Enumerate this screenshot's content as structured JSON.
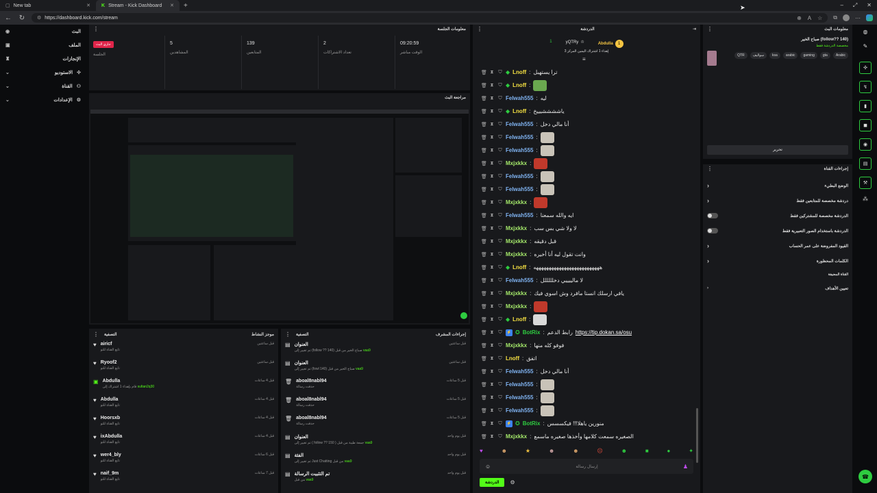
{
  "browser": {
    "tabs": [
      {
        "title": "New tab"
      },
      {
        "title": "Stream - Kick Dashboard"
      }
    ],
    "url": "https://dashboard.kick.com/stream"
  },
  "sidebar": {
    "items": [
      {
        "label": "البث",
        "icon": "broadcast-icon"
      },
      {
        "label": "الملف",
        "icon": "profile-icon"
      },
      {
        "label": "الإنجازات",
        "icon": "trophy-icon"
      },
      {
        "label": "الاستوديو",
        "icon": "studio-icon"
      },
      {
        "label": "القناة",
        "icon": "channel-icon"
      },
      {
        "label": "الإعدادات",
        "icon": "gear-icon"
      }
    ]
  },
  "session": {
    "header": "معلومات الجلسة",
    "stats": [
      {
        "value": "جاري البث",
        "label": "الجلسة"
      },
      {
        "value": "5",
        "label": "المشاهدين"
      },
      {
        "value": "139",
        "label": "المتابعين"
      },
      {
        "value": "2",
        "label": "تعداد الاشتراكات"
      },
      {
        "value": "09:20:59",
        "label": "الوقت مباشر"
      }
    ]
  },
  "preview": {
    "header": "مراجعة البث"
  },
  "activity": {
    "header": "موجز النشاط",
    "filter": "التصفية",
    "items": [
      {
        "name": "airicf",
        "sub": "تابع القناة للتو",
        "time": "قبل ساعتين"
      },
      {
        "name": "Ryoof2",
        "sub": "تابع القناة للتو",
        "time": "قبل ساعتين"
      },
      {
        "name": "Abdulla",
        "sub": "قام بإهداء 1 اشتراك إلى",
        "extra": "sultan2q30",
        "time": "قبل 4 ساعات"
      },
      {
        "name": "Abdulla",
        "sub": "تابع القناة للتو",
        "time": "قبل 4 ساعات"
      },
      {
        "name": "Hoorsxb",
        "sub": "تابع القناة للتو",
        "time": "قبل 4 ساعات"
      },
      {
        "name": "ixAbdulla",
        "sub": "تابع القناة للتو",
        "time": "قبل 4 ساعات"
      },
      {
        "name": "wer4_bly",
        "sub": "تابع القناة للتو",
        "time": "قبل 6 ساعات"
      },
      {
        "name": "naif_9m",
        "sub": "تابع القناة للتو",
        "time": "قبل 7 ساعات"
      }
    ]
  },
  "modactions": {
    "header": "إجراءات المشرف",
    "filter": "التصفية",
    "items": [
      {
        "name": "العنوان",
        "sub": "تم تغيير إلى (follow ?? 140) صباح الخير من قبل",
        "by": "vaa9",
        "time": "قبل ساعتين"
      },
      {
        "name": "العنوان",
        "sub": "تم تغيير إلى (fowl 140) صباح الخير من قبل",
        "by": "vaa9",
        "time": "قبل ساعتين"
      },
      {
        "name": "aboal8nabl94",
        "sub": "حذفت رسالة",
        "time": "قبل 5 ساعات"
      },
      {
        "name": "aboal8nabl94",
        "sub": "حذفت رسالة",
        "time": "قبل 5 ساعات"
      },
      {
        "name": "aboal8nabl94",
        "sub": "حذفت رسالة",
        "time": "قبل 5 ساعات"
      },
      {
        "name": "العنوان",
        "sub": "تم تغيير إلى ( follow ?? 150 ) جمعة طيبة من قبل",
        "by": "vaa9",
        "time": "قبل يوم واحد"
      },
      {
        "name": "الفئة",
        "sub": "تم تغيير إلى Just Chatting من قبل",
        "by": "vaa9",
        "time": "قبل يوم واحد"
      },
      {
        "name": "تم التثبيت الرسالة",
        "sub": "من قبل",
        "by": "vaa9",
        "time": "قبل يوم واحد"
      }
    ]
  },
  "chat": {
    "header": "الدردشة",
    "top_users": [
      {
        "name": "Abdulla",
        "count": "1"
      },
      {
        "name": "yQTRy",
        "count": "1"
      },
      {
        "name": "",
        "count": "1"
      }
    ],
    "gift_text": "إهداء 1 اشتراك اليمين المركز 3",
    "messages": [
      {
        "user": "Lnoff",
        "color": "#f5e042",
        "badge": true,
        "text": "ترا يستهبل"
      },
      {
        "user": "Lnoff",
        "color": "#f5e042",
        "badge": true,
        "text": "",
        "emote": "#6aa84f"
      },
      {
        "user": "Felwah555",
        "color": "#7fb2f0",
        "text": "ليه"
      },
      {
        "user": "Lnoff",
        "color": "#f5e042",
        "badge": true,
        "text": "ياششششيييخ"
      },
      {
        "user": "Felwah555",
        "color": "#7fb2f0",
        "text": "أنا مالي دخل"
      },
      {
        "user": "Felwah555",
        "color": "#7fb2f0",
        "text": "",
        "emote": "#c9c3b8"
      },
      {
        "user": "Felwah555",
        "color": "#7fb2f0",
        "text": "",
        "emote": "#c9c3b8"
      },
      {
        "user": "Mxjxkkx",
        "color": "#a4e86a",
        "text": "",
        "emote": "#c0392b"
      },
      {
        "user": "Felwah555",
        "color": "#7fb2f0",
        "text": "",
        "emote": "#c9c3b8"
      },
      {
        "user": "Felwah555",
        "color": "#7fb2f0",
        "text": "",
        "emote": "#c9c3b8"
      },
      {
        "user": "Mxjxkkx",
        "color": "#a4e86a",
        "text": "",
        "emote": "#c0392b"
      },
      {
        "user": "Felwah555",
        "color": "#7fb2f0",
        "text": "ايه والله سمعنا"
      },
      {
        "user": "Mxjxkkx",
        "color": "#a4e86a",
        "text": "لا ولا شي بس سب"
      },
      {
        "user": "Mxjxkkx",
        "color": "#a4e86a",
        "text": "قبل دقيقه"
      },
      {
        "user": "Mxjxkkx",
        "color": "#a4e86a",
        "text": "وانت تقول ليه أنا أخيره"
      },
      {
        "user": "Lnoff",
        "color": "#f5e042",
        "badge": true,
        "text": "ههههههههههههههههههههههههههه"
      },
      {
        "user": "Felwah555",
        "color": "#7fb2f0",
        "text": "لا مالييييي دخلللللل"
      },
      {
        "user": "Mxjxkkx",
        "color": "#a4e86a",
        "text": "يافي ارسلك انستا مافرد وش اسوي فيك"
      },
      {
        "user": "Mxjxkkx",
        "color": "#a4e86a",
        "text": "",
        "emote": "#c0392b"
      },
      {
        "user": "Lnoff",
        "color": "#f5e042",
        "badge": true,
        "text": "",
        "emote": "#d9d9d9"
      },
      {
        "user": "BotRix",
        "color": "#2ecc40",
        "bot": true,
        "text": "رابط الدعم",
        "link": "https://tip.dokan.sa/osu"
      },
      {
        "user": "Mxjxkkx",
        "color": "#a4e86a",
        "text": "فوفو كله منها"
      },
      {
        "user": "Lnoff",
        "color": "#f5e042",
        "text": "اتفق"
      },
      {
        "user": "Felwah555",
        "color": "#7fb2f0",
        "text": "أنا مالي دخل"
      },
      {
        "user": "Felwah555",
        "color": "#7fb2f0",
        "text": "",
        "emote": "#c9c3b8"
      },
      {
        "user": "Felwah555",
        "color": "#7fb2f0",
        "text": "",
        "emote": "#c9c3b8"
      },
      {
        "user": "Felwah555",
        "color": "#7fb2f0",
        "text": "",
        "emote": "#c9c3b8"
      },
      {
        "user": "BotRix",
        "color": "#2ecc40",
        "bot": true,
        "text": "منورين ياهلا!!! فيكسسس"
      },
      {
        "user": "Mxjxkkx",
        "color": "#a4e86a",
        "text": "الصغيره سمعت كلامها وأخذها صغيره ماسمع"
      }
    ],
    "input_placeholder": "إرسال رسالة",
    "send_label": "الدردشة"
  },
  "stream_info": {
    "header": "معلومات البث",
    "title": "صباح الخير (follow?? 140)",
    "category": "مخصصة الدردشة فقط",
    "tags": [
      "Arabic",
      "gta",
      "gaming",
      "arabic",
      "ksa",
      "سواليف",
      "QTR"
    ],
    "edit_label": "تحرير"
  },
  "channel_actions": {
    "header": "إجراءات القناة",
    "items": [
      {
        "label": "الوضع البطيء",
        "type": "chevron"
      },
      {
        "label": "دردشة مخصصة للمتابعين فقط",
        "type": "chevron"
      },
      {
        "label": "الدردشة مخصصة للمشتركين فقط",
        "type": "toggle"
      },
      {
        "label": "الدردشة باستخدام الصور التعبيرية فقط",
        "type": "toggle"
      },
      {
        "label": "القيود المفروضة على عمر الحساب",
        "type": "chevron"
      },
      {
        "label": "الكلمات المحظورة",
        "type": "chevron"
      }
    ],
    "section": "القناة المضيفة",
    "goals_label": "تعيين الأهداف"
  },
  "colors": {
    "accent": "#53fc18",
    "panel": "#18191c",
    "live": "#e0254a"
  }
}
